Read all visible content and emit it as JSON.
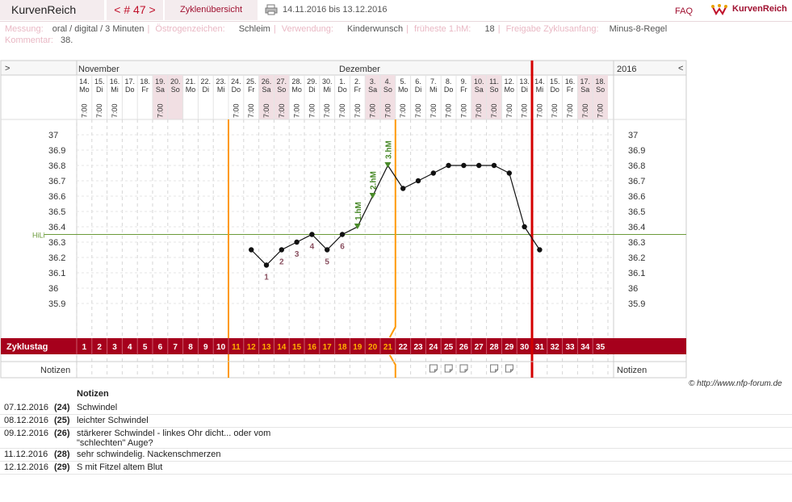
{
  "header": {
    "app_title": "KurvenReich",
    "cycle_nav": "< # 47 >",
    "overview_label": "Zyklenübersicht",
    "date_range": "14.11.2016 bis 13.12.2016",
    "faq": "FAQ",
    "logo_text": "KurvenReich"
  },
  "meta": {
    "messung_label": "Messung:",
    "messung": "oral / digital / 3 Minuten",
    "oestrogen_label": "Östrogenzeichen:",
    "oestrogen": "Schleim",
    "verwendung_label": "Verwendung:",
    "verwendung": "Kinderwunsch",
    "frueheste_label": "früheste 1.hM:",
    "frueheste": "18",
    "freigabe_label": "Freigabe Zyklusanfang:",
    "freigabe": "Minus-8-Regel",
    "kommentar_label": "Kommentar:",
    "kommentar": "38."
  },
  "chart_labels": {
    "nav_left": ">",
    "nav_right": "<",
    "month_1": "November",
    "month_2": "Dezember",
    "year": "2016",
    "zyklustag": "Zyklustag",
    "notizen": "Notizen",
    "notizen_right": "Notizen",
    "hili": "HiLi"
  },
  "colors": {
    "accent": "#a6001c",
    "weekend": "#f1dfe3",
    "orange": "#ff9900",
    "red_line": "#d40000",
    "coverline": "#6b9a3a",
    "marker_green": "#4a8a2a",
    "lowlabel": "#8a5060"
  },
  "chart_data": {
    "type": "line",
    "title": "",
    "ylabel": "",
    "ylim": [
      35.8,
      37.1
    ],
    "yticks": [
      35.9,
      36,
      36.1,
      36.2,
      36.3,
      36.4,
      36.5,
      36.6,
      36.7,
      36.8,
      36.9,
      37
    ],
    "coverline": 36.35,
    "days": [
      {
        "date": "14.",
        "wd": "Mo",
        "time": "7:00",
        "cd": "",
        "we": false
      },
      {
        "date": "15.",
        "wd": "Di",
        "time": "7:00",
        "cd": "",
        "we": false
      },
      {
        "date": "16.",
        "wd": "Mi",
        "time": "7:00",
        "cd": "",
        "we": false
      },
      {
        "date": "17.",
        "wd": "Do",
        "time": "",
        "cd": "",
        "we": false
      },
      {
        "date": "18.",
        "wd": "Fr",
        "time": "",
        "cd": "",
        "we": false
      },
      {
        "date": "19.",
        "wd": "Sa",
        "time": "7:00",
        "cd": "",
        "we": true
      },
      {
        "date": "20.",
        "wd": "So",
        "time": "",
        "cd": "",
        "we": true
      },
      {
        "date": "21.",
        "wd": "Mo",
        "time": "",
        "cd": "",
        "we": false
      },
      {
        "date": "22.",
        "wd": "Di",
        "time": "",
        "cd": "",
        "we": false
      },
      {
        "date": "23.",
        "wd": "Mi",
        "time": "",
        "cd": "",
        "we": false
      },
      {
        "date": "24.",
        "wd": "Do",
        "time": "7:00",
        "cd": "",
        "we": false
      },
      {
        "date": "25.",
        "wd": "Fr",
        "time": "7:00",
        "cd": "",
        "we": false
      },
      {
        "date": "26.",
        "wd": "Sa",
        "time": "7:00",
        "cd": "",
        "we": true
      },
      {
        "date": "27.",
        "wd": "So",
        "time": "7:00",
        "cd": "",
        "we": true
      },
      {
        "date": "28.",
        "wd": "Mo",
        "time": "7:00",
        "cd": "",
        "we": false
      },
      {
        "date": "29.",
        "wd": "Di",
        "time": "7:00",
        "cd": "",
        "we": false
      },
      {
        "date": "30.",
        "wd": "Mi",
        "time": "7:00",
        "cd": "",
        "we": false
      },
      {
        "date": "1.",
        "wd": "Do",
        "time": "7:00",
        "cd": "",
        "we": false
      },
      {
        "date": "2.",
        "wd": "Fr",
        "time": "7:00",
        "cd": "",
        "we": false
      },
      {
        "date": "3.",
        "wd": "Sa",
        "time": "7:00",
        "cd": "",
        "we": true
      },
      {
        "date": "4.",
        "wd": "So",
        "time": "7:00",
        "cd": "",
        "we": true
      },
      {
        "date": "5.",
        "wd": "Mo",
        "time": "7:00",
        "cd": "",
        "we": false
      },
      {
        "date": "6.",
        "wd": "Di",
        "time": "7:00",
        "cd": "",
        "we": false
      },
      {
        "date": "7.",
        "wd": "Mi",
        "time": "7:00",
        "cd": "",
        "we": false
      },
      {
        "date": "8.",
        "wd": "Do",
        "time": "7:00",
        "cd": "",
        "we": false
      },
      {
        "date": "9.",
        "wd": "Fr",
        "time": "7:00",
        "cd": "",
        "we": false
      },
      {
        "date": "10.",
        "wd": "Sa",
        "time": "7:00",
        "cd": "",
        "we": true
      },
      {
        "date": "11.",
        "wd": "So",
        "time": "7:00",
        "cd": "",
        "we": true
      },
      {
        "date": "12.",
        "wd": "Mo",
        "time": "7:00",
        "cd": "",
        "we": false
      },
      {
        "date": "13.",
        "wd": "Di",
        "time": "7:00",
        "cd": "",
        "we": false
      },
      {
        "date": "14.",
        "wd": "Mi",
        "time": "7:00",
        "cd": "",
        "we": false
      },
      {
        "date": "15.",
        "wd": "Do",
        "time": "7:00",
        "cd": "",
        "we": false
      },
      {
        "date": "16.",
        "wd": "Fr",
        "time": "7:00",
        "cd": "",
        "we": false
      },
      {
        "date": "17.",
        "wd": "Sa",
        "time": "7:00",
        "cd": "",
        "we": true
      },
      {
        "date": "18.",
        "wd": "So",
        "time": "7:00",
        "cd": "",
        "we": true
      }
    ],
    "cycle_days": [
      1,
      2,
      3,
      4,
      5,
      6,
      7,
      8,
      9,
      10,
      11,
      12,
      13,
      14,
      15,
      16,
      17,
      18,
      19,
      20,
      21,
      22,
      23,
      24,
      25,
      26,
      27,
      28,
      29,
      30,
      31,
      32,
      33,
      34,
      35
    ],
    "orange_days": [
      11,
      12,
      13,
      14,
      15,
      16,
      17,
      18,
      19,
      20,
      21
    ],
    "temps": [
      {
        "cd": 12,
        "t": 36.25
      },
      {
        "cd": 13,
        "t": 36.15
      },
      {
        "cd": 14,
        "t": 36.25
      },
      {
        "cd": 15,
        "t": 36.3
      },
      {
        "cd": 16,
        "t": 36.35
      },
      {
        "cd": 17,
        "t": 36.25
      },
      {
        "cd": 18,
        "t": 36.35
      },
      {
        "cd": 19,
        "t": 36.4
      },
      {
        "cd": 20,
        "t": 36.6
      },
      {
        "cd": 21,
        "t": 36.8
      },
      {
        "cd": 22,
        "t": 36.65
      },
      {
        "cd": 23,
        "t": 36.7
      },
      {
        "cd": 24,
        "t": 36.75
      },
      {
        "cd": 25,
        "t": 36.8
      },
      {
        "cd": 26,
        "t": 36.8
      },
      {
        "cd": 27,
        "t": 36.8
      },
      {
        "cd": 28,
        "t": 36.8
      },
      {
        "cd": 29,
        "t": 36.75
      },
      {
        "cd": 30,
        "t": 36.4
      },
      {
        "cd": 31,
        "t": 36.25
      }
    ],
    "low_labels": [
      {
        "cd": 13,
        "label": "1"
      },
      {
        "cd": 14,
        "label": "2"
      },
      {
        "cd": 15,
        "label": "3"
      },
      {
        "cd": 16,
        "label": "4"
      },
      {
        "cd": 17,
        "label": "5"
      },
      {
        "cd": 18,
        "label": "6"
      }
    ],
    "high_labels": [
      {
        "cd": 19,
        "label": "1.hM"
      },
      {
        "cd": 20,
        "label": "2.hM"
      },
      {
        "cd": 21,
        "label": "3.hM"
      }
    ],
    "note_icon_days": [
      24,
      25,
      26,
      28,
      29
    ]
  },
  "notes": {
    "heading": "Notizen",
    "rows": [
      {
        "date": "07.12.2016",
        "cd": "(24)",
        "text": "Schwindel"
      },
      {
        "date": "08.12.2016",
        "cd": "(25)",
        "text": "leichter Schwindel"
      },
      {
        "date": "09.12.2016",
        "cd": "(26)",
        "text": "stärkerer Schwindel - linkes Ohr dicht... oder vom \"schlechten\" Auge?"
      },
      {
        "date": "11.12.2016",
        "cd": "(28)",
        "text": "sehr schwindelig. Nackenschmerzen"
      },
      {
        "date": "12.12.2016",
        "cd": "(29)",
        "text": "S mit Fitzel altem Blut"
      }
    ]
  },
  "copyright": "© http://www.nfp-forum.de"
}
